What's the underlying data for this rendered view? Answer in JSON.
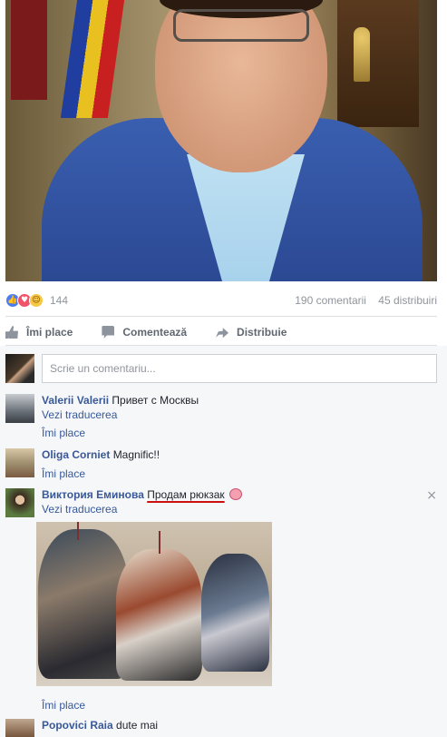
{
  "post": {
    "reactions": {
      "icons": [
        "like-icon",
        "love-icon",
        "haha-icon"
      ],
      "count": "144"
    },
    "comments_count": "190 comentarii",
    "shares_count": "45 distribuiri",
    "actions": {
      "like_label": "Îmi place",
      "comment_label": "Comentează",
      "share_label": "Distribuie"
    }
  },
  "composer": {
    "placeholder": "Scrie un comentariu..."
  },
  "comments": [
    {
      "author": "Valerii Valerii",
      "text": "Привет с Москвы",
      "translate_link": "Vezi traducerea",
      "like_link": "Îmi place"
    },
    {
      "author": "Oliga Corniet",
      "text": "Magnific!!",
      "like_link": "Îmi place"
    },
    {
      "author": "Виктория Еминова",
      "text": "Продам рюкзак",
      "emoji": "pig-face-icon",
      "translate_link": "Vezi traducerea",
      "like_link": "Îmi place",
      "close": "×"
    },
    {
      "author": "Popovici Raia",
      "text": "dute mai"
    }
  ],
  "colors": {
    "link_blue": "#385898",
    "muted_gray": "#90949c",
    "comments_background": "#f6f7f9",
    "annotation_red": "#cc1010"
  }
}
